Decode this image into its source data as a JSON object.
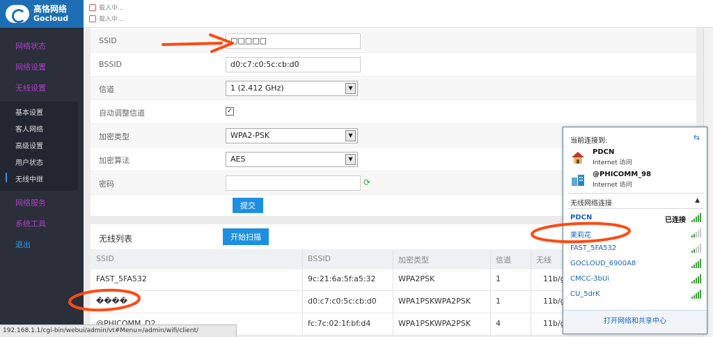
{
  "brand": {
    "name_cn": "高恪网络",
    "name_en": "Gocloud"
  },
  "loading": [
    "载入中...",
    "载入中..."
  ],
  "sidebar": {
    "top_items": [
      "网络状态",
      "网络设置",
      "无线设置"
    ],
    "sub_items": [
      "基本设置",
      "客人网络",
      "高级设置",
      "用户状态",
      "无线中继"
    ],
    "bottom_items": [
      "网络服务",
      "系统工具"
    ],
    "exit": "退出"
  },
  "form": {
    "ssid_label": "SSID",
    "ssid_value": "□□□□□",
    "bssid_label": "BSSID",
    "bssid_value": "d0:c7:c0:5c:cb:d0",
    "channel_label": "信道",
    "channel_value": "1 (2.412 GHz)",
    "auto_channel_label": "自动调整信道",
    "auto_channel_checked": "✓",
    "enc_type_label": "加密类型",
    "enc_type_value": "WPA2-PSK",
    "enc_alg_label": "加密算法",
    "enc_alg_value": "AES",
    "password_label": "密码",
    "password_value": "",
    "submit_label": "提交"
  },
  "wlist": {
    "title": "无线列表",
    "scan_label": "开始扫描",
    "headers": [
      "SSID",
      "BSSID",
      "加密类型",
      "信道",
      "无线"
    ],
    "rows": [
      [
        "FAST_5FA532",
        "9c:21:6a:5f:a5:32",
        "WPA2PSK",
        "1",
        "11b/g"
      ],
      [
        "����",
        "d0:c7:c0:5c:cb:d0",
        "WPA1PSKWPA2PSK",
        "1",
        "11b/g"
      ],
      [
        "@PHICOMM_D2",
        "fc:7c:02:1f:bf:d4",
        "WPA1PSKWPA2PSK",
        "4",
        "11b/g"
      ]
    ]
  },
  "statusbar": "192.168.1.1/cgi-bin/webui/admin/vt#Menu=/admin/wifi/client/",
  "netpop": {
    "header": "当前连接到:",
    "connections": [
      {
        "name": "PDCN",
        "status": "Internet 访问"
      },
      {
        "name": "@PHICOMM_98",
        "status": "Internet 访问"
      }
    ],
    "section": "无线网络连接",
    "networks": [
      {
        "name": "PDCN",
        "status": "已连接",
        "signal": 5
      },
      {
        "name": "茉莉花",
        "status": "",
        "signal": 2
      },
      {
        "name": "FAST_5FA532",
        "status": "",
        "signal": 2
      },
      {
        "name": "GOCLOUD_6900A8",
        "status": "",
        "signal": 5
      },
      {
        "name": "CMCC-3bUi",
        "status": "",
        "signal": 5
      },
      {
        "name": "CU_5drK",
        "status": "",
        "signal": 5
      }
    ],
    "footer": "打开网络和共享中心"
  },
  "colors": {
    "sidebar": "#2a2f3a",
    "accent": "#1e8fe0",
    "annotation": "#ff4a12"
  }
}
